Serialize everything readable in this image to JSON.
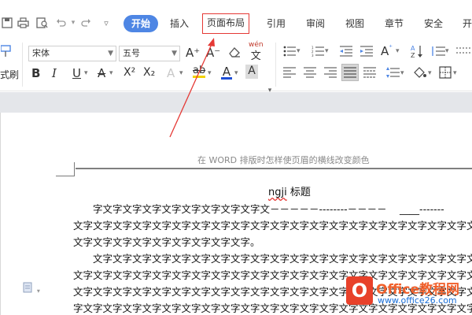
{
  "quick_access": {
    "icons": [
      "save-icon",
      "print-icon",
      "preview-icon",
      "undo-icon",
      "redo-icon",
      "customize-icon"
    ]
  },
  "tabs": [
    {
      "label": "开始",
      "active": true
    },
    {
      "label": "插入"
    },
    {
      "label": "页面布局",
      "highlighted": true
    },
    {
      "label": "引用"
    },
    {
      "label": "审阅"
    },
    {
      "label": "视图"
    },
    {
      "label": "章节"
    },
    {
      "label": "安全"
    },
    {
      "label": "开"
    }
  ],
  "ribbon": {
    "format_painter_label": "式刷",
    "font_name": "宋体",
    "font_size": "五号",
    "grow_font": "A⁺",
    "shrink_font": "A⁻",
    "clear_format": "◇",
    "phonetic": "wén",
    "bold": "B",
    "italic": "I",
    "underline": "U",
    "strikethrough": "A",
    "superscript": "X²",
    "subscript": "X₂",
    "text_effect": "A",
    "highlight": "ab",
    "font_color": "A",
    "char_shading": "A"
  },
  "colors": {
    "accent": "#4e86e4",
    "highlight_box": "#e53935",
    "arrow": "#e53935",
    "font_color_bar": "#1f4fd6",
    "highlight_bar": "#f2d200",
    "watermark_logo": "#e8412a",
    "watermark_title": "#f0602c",
    "watermark_url": "#1a6fd8"
  },
  "document": {
    "header_text": "在 WORD 排版时怎样使页眉的横线改变颜色",
    "title_part1": "ngji",
    "title_part2": " 标题",
    "lines": [
      "　　字文字文字文字文字文字文字文字文字文－－－－－--------－－－－　 ____-------",
      "文字文字文字文字文字文字文字文字文字文字文字文字文字文字文字文字文字文字文字文字文字文字",
      "文字文字文字文字文字文字文字文字文字。",
      "　　文字文字文字文字文字文字文字文字文字文字文字文字文字文字文字文字文字文字文字文字文字",
      "文字文字文字文字文字文字文字文字文字文字文字文字文字文字文字文字文字文字文字文字文字文字",
      "文字文字文字文字文字文字文字文字文字文字文字文字文字文字文字文字文字文字文字文字文字文字",
      "字文字文字文字文字文字文字文字文字文字文字文字文字文字文字文字文字文字文字文字文字文字文字"
    ]
  },
  "watermark": {
    "logo_char": "O",
    "title": "Office教程网",
    "url": "www.office26.com"
  }
}
